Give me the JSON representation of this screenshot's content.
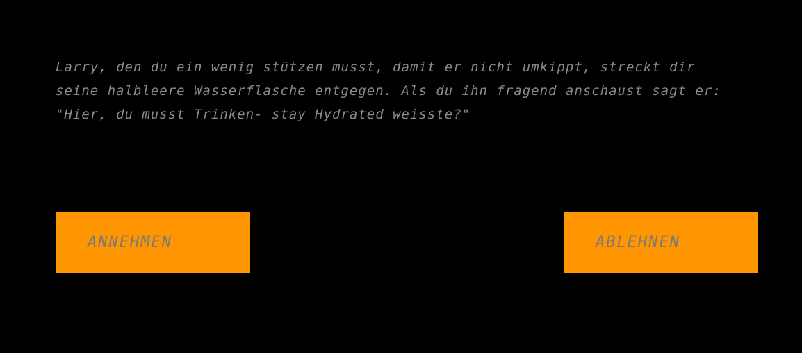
{
  "dialog": {
    "text": "Larry, den du ein wenig stützen musst, damit er nicht umkippt, streckt dir seine halbleere Wasserflasche entgegen. Als du ihn fragend anschaust sagt er: \"Hier, du musst Trinken- stay Hydrated weisste?\""
  },
  "choices": {
    "accept_label": "ANNEHMEN",
    "decline_label": "ABLEHNEN"
  },
  "colors": {
    "background": "#000000",
    "button": "#ff9500",
    "text": "#8a8a8a"
  }
}
